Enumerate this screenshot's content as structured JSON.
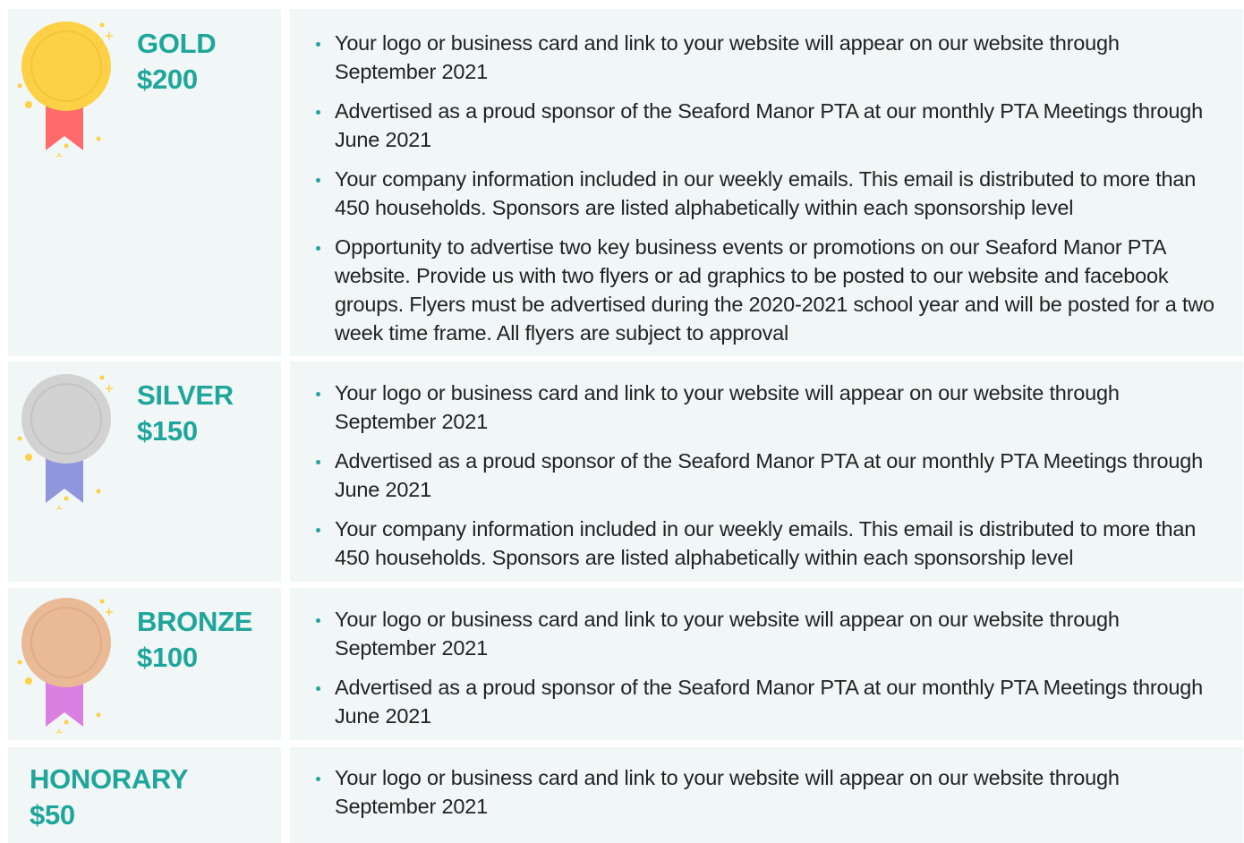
{
  "colors": {
    "accent": "#1fa69a",
    "panel": "#f1f6f7",
    "gold": "#fed045",
    "gold_ribbon": "#ff6a6a",
    "silver": "#d2d2d2",
    "silver_ribbon": "#8f96dc",
    "bronze": "#eab995",
    "bronze_ribbon": "#da80e3"
  },
  "tiers": [
    {
      "name": "GOLD",
      "price": "$200",
      "medal_icon": "gold-medal-icon",
      "benefits": [
        "Your logo or business card and link to your website will appear on our website through September 2021",
        "Advertised as a proud sponsor of the Seaford Manor PTA at our monthly PTA Meetings through June 2021",
        "Your company information included in our weekly emails. This email is distributed to more than 450 households. Sponsors are listed alphabetically within each sponsorship level",
        "Opportunity to advertise two key business events or promotions on our Seaford Manor PTA website. Provide us with two flyers or ad graphics to be posted to our website and facebook groups. Flyers must be advertised during the 2020-2021 school year and will be posted for a two week time frame. All flyers are subject to approval"
      ]
    },
    {
      "name": "SILVER",
      "price": "$150",
      "medal_icon": "silver-medal-icon",
      "benefits": [
        "Your logo or business card and link to your website will appear on our website through September 2021",
        "Advertised as a proud sponsor of the Seaford Manor PTA at our monthly PTA Meetings through June 2021",
        "Your company information included in our weekly emails. This email is distributed to more than 450 households. Sponsors are listed alphabetically within each sponsorship level"
      ]
    },
    {
      "name": "BRONZE",
      "price": "$100",
      "medal_icon": "bronze-medal-icon",
      "benefits": [
        "Your logo or business card and link to your website will appear on our website through September 2021",
        "Advertised as a proud sponsor of the Seaford Manor PTA at our monthly PTA Meetings through June 2021"
      ]
    },
    {
      "name": "HONORARY",
      "price": "$50",
      "benefits": [
        "Your logo or business card and link to your website will appear on our website through September 2021"
      ]
    }
  ]
}
